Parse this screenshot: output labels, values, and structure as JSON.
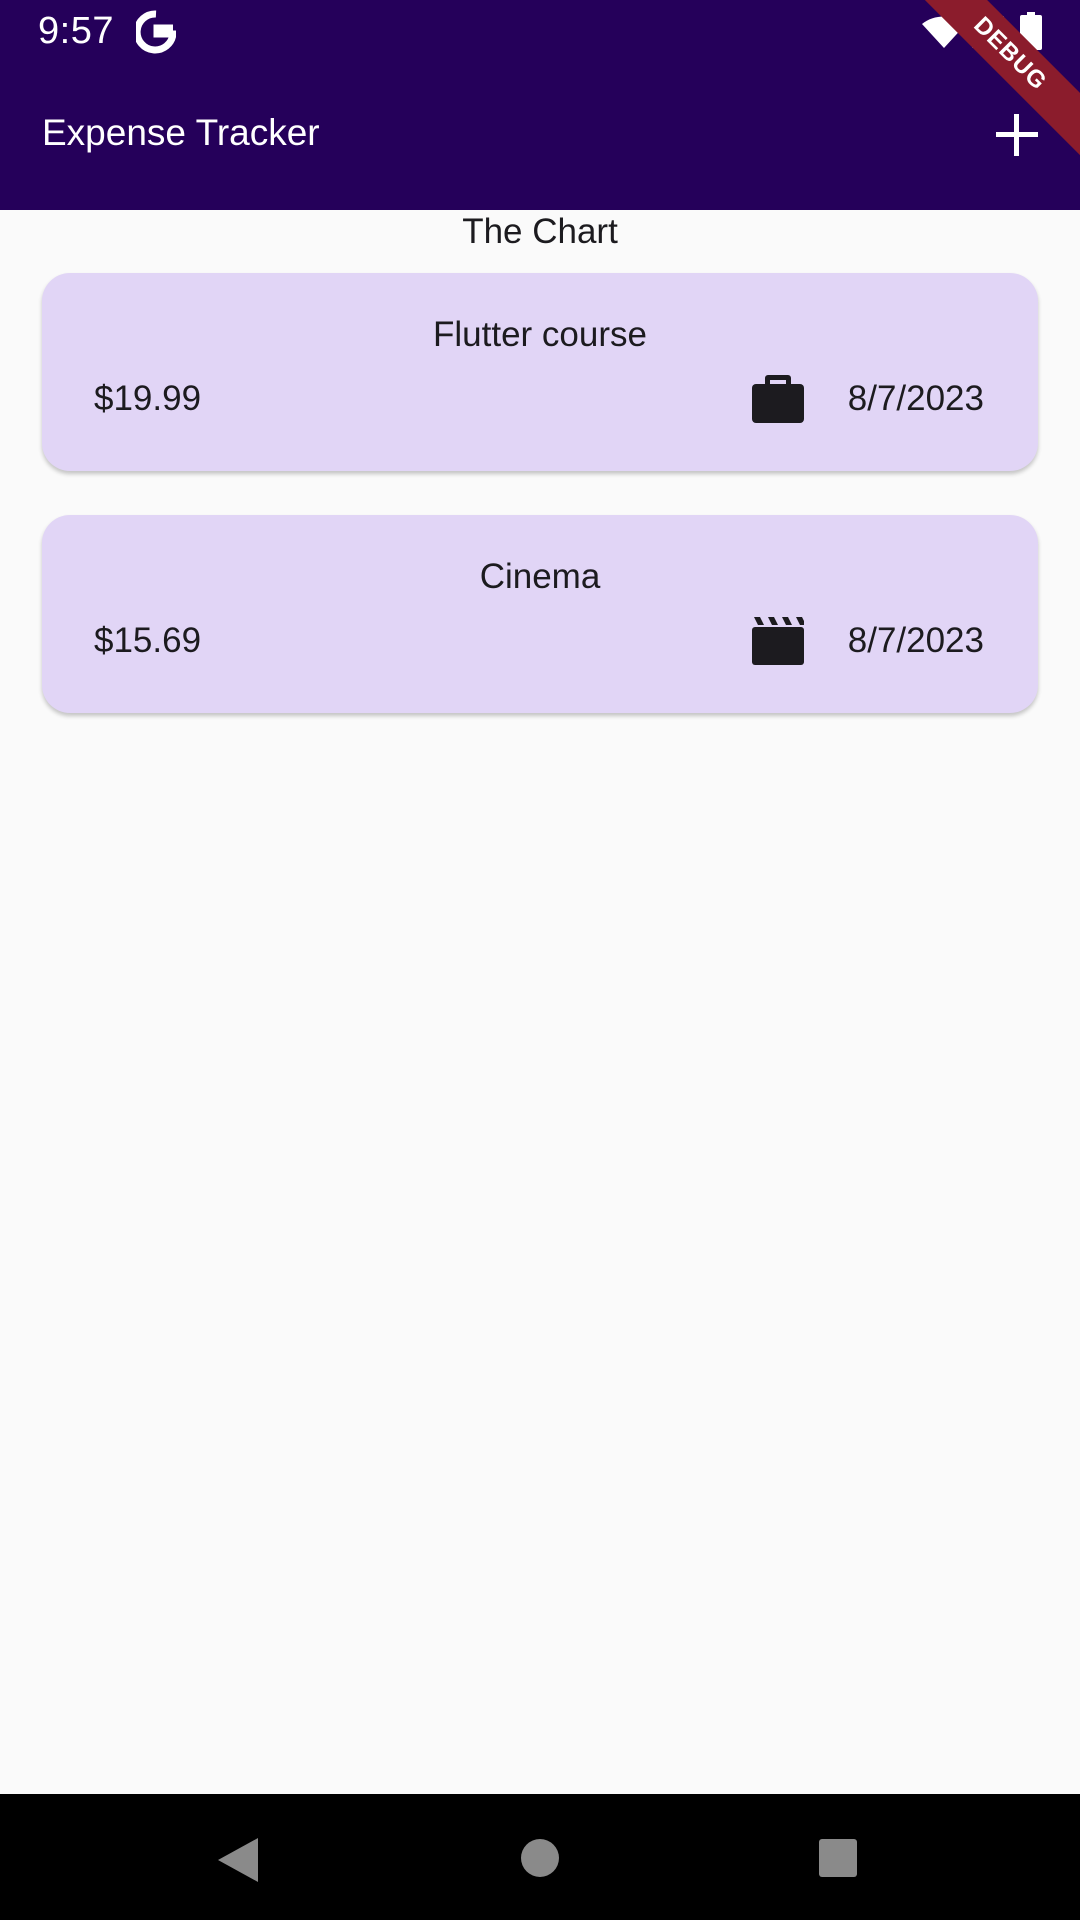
{
  "status_bar": {
    "time": "9:57",
    "icons": [
      "google-g-icon",
      "wifi-icon",
      "signal-icon",
      "battery-icon"
    ]
  },
  "app_bar": {
    "title": "Expense Tracker",
    "add_icon": "plus-icon"
  },
  "debug_banner": "DEBUG",
  "chart_placeholder": "The Chart",
  "expenses": [
    {
      "title": "Flutter course",
      "amount": "$19.99",
      "category_icon": "briefcase-icon",
      "date": "8/7/2023"
    },
    {
      "title": "Cinema",
      "amount": "$15.69",
      "category_icon": "clapperboard-icon",
      "date": "8/7/2023"
    }
  ],
  "nav_bar": {
    "icons": [
      "back-icon",
      "home-icon",
      "recents-icon"
    ]
  },
  "colors": {
    "app_bar": "#25005a",
    "card_background": "#e1d5f6",
    "debug_banner": "#8b1c2c",
    "background": "#fafafa"
  }
}
